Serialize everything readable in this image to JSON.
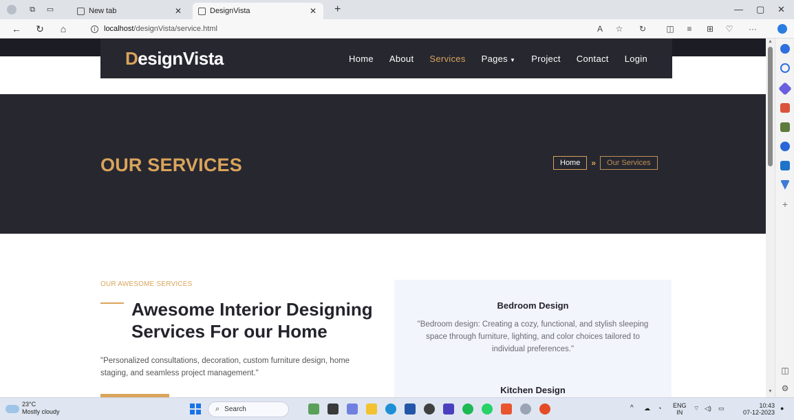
{
  "browser": {
    "tabs": [
      {
        "label": "New tab",
        "active": false
      },
      {
        "label": "DesignVista",
        "active": true
      }
    ],
    "url_host": "localhost",
    "url_path": "/designVista/service.html"
  },
  "site": {
    "logo_first": "D",
    "logo_rest": "esignVista",
    "nav": [
      {
        "label": "Home"
      },
      {
        "label": "About"
      },
      {
        "label": "Services",
        "active": true
      },
      {
        "label": "Pages"
      },
      {
        "label": "Project"
      },
      {
        "label": "Contact"
      },
      {
        "label": "Login"
      }
    ],
    "accent_color": "#d9a45b",
    "dark_color": "#272730"
  },
  "hero": {
    "title": "OUR SERVICES",
    "breadcrumb_home": "Home",
    "breadcrumb_sep": "»",
    "breadcrumb_current": "Our Services"
  },
  "services_intro": {
    "eyebrow": "OUR AWESOME SERVICES",
    "heading": "Awesome Interior Designing Services For our Home",
    "description": "\"Personalized consultations, decoration, custom furniture design, home staging, and seamless project management.\""
  },
  "services": [
    {
      "title": "Bedroom Design",
      "text": "\"Bedroom design: Creating a cozy, functional, and stylish sleeping space through furniture, lighting, and color choices tailored to individual preferences.\""
    },
    {
      "title": "Kitchen Design"
    }
  ],
  "taskbar": {
    "temperature": "23°C",
    "weather": "Mostly cloudy",
    "search": "Search",
    "lang_top": "ENG",
    "lang_bottom": "IN",
    "time": "10:43",
    "date": "07-12-2023"
  }
}
